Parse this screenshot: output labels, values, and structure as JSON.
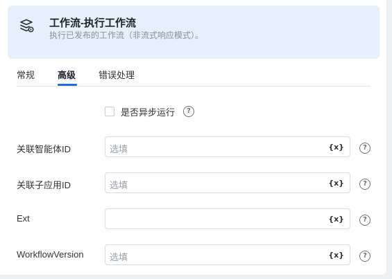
{
  "header": {
    "title": "工作流-执行工作流",
    "description": "执行已发布的工作流（非流式响应模式）。",
    "icon": "workflow-stack-icon"
  },
  "tabs": [
    {
      "label": "常规",
      "active": false
    },
    {
      "label": "高级",
      "active": true
    },
    {
      "label": "错误处理",
      "active": false
    }
  ],
  "accent_color": "#1d6fe0",
  "async_option": {
    "label": "是否异步运行",
    "checked": false
  },
  "fields": [
    {
      "label": "关联智能体ID",
      "placeholder": "选填",
      "value": "",
      "var_icon": "{x}"
    },
    {
      "label": "关联子应用ID",
      "placeholder": "选填",
      "value": "",
      "var_icon": "{x}"
    },
    {
      "label": "Ext",
      "placeholder": "",
      "value": "",
      "var_icon": "{x}"
    },
    {
      "label": "WorkflowVersion",
      "placeholder": "选填",
      "value": "",
      "var_icon": "{x}"
    }
  ],
  "help_glyph": "?"
}
